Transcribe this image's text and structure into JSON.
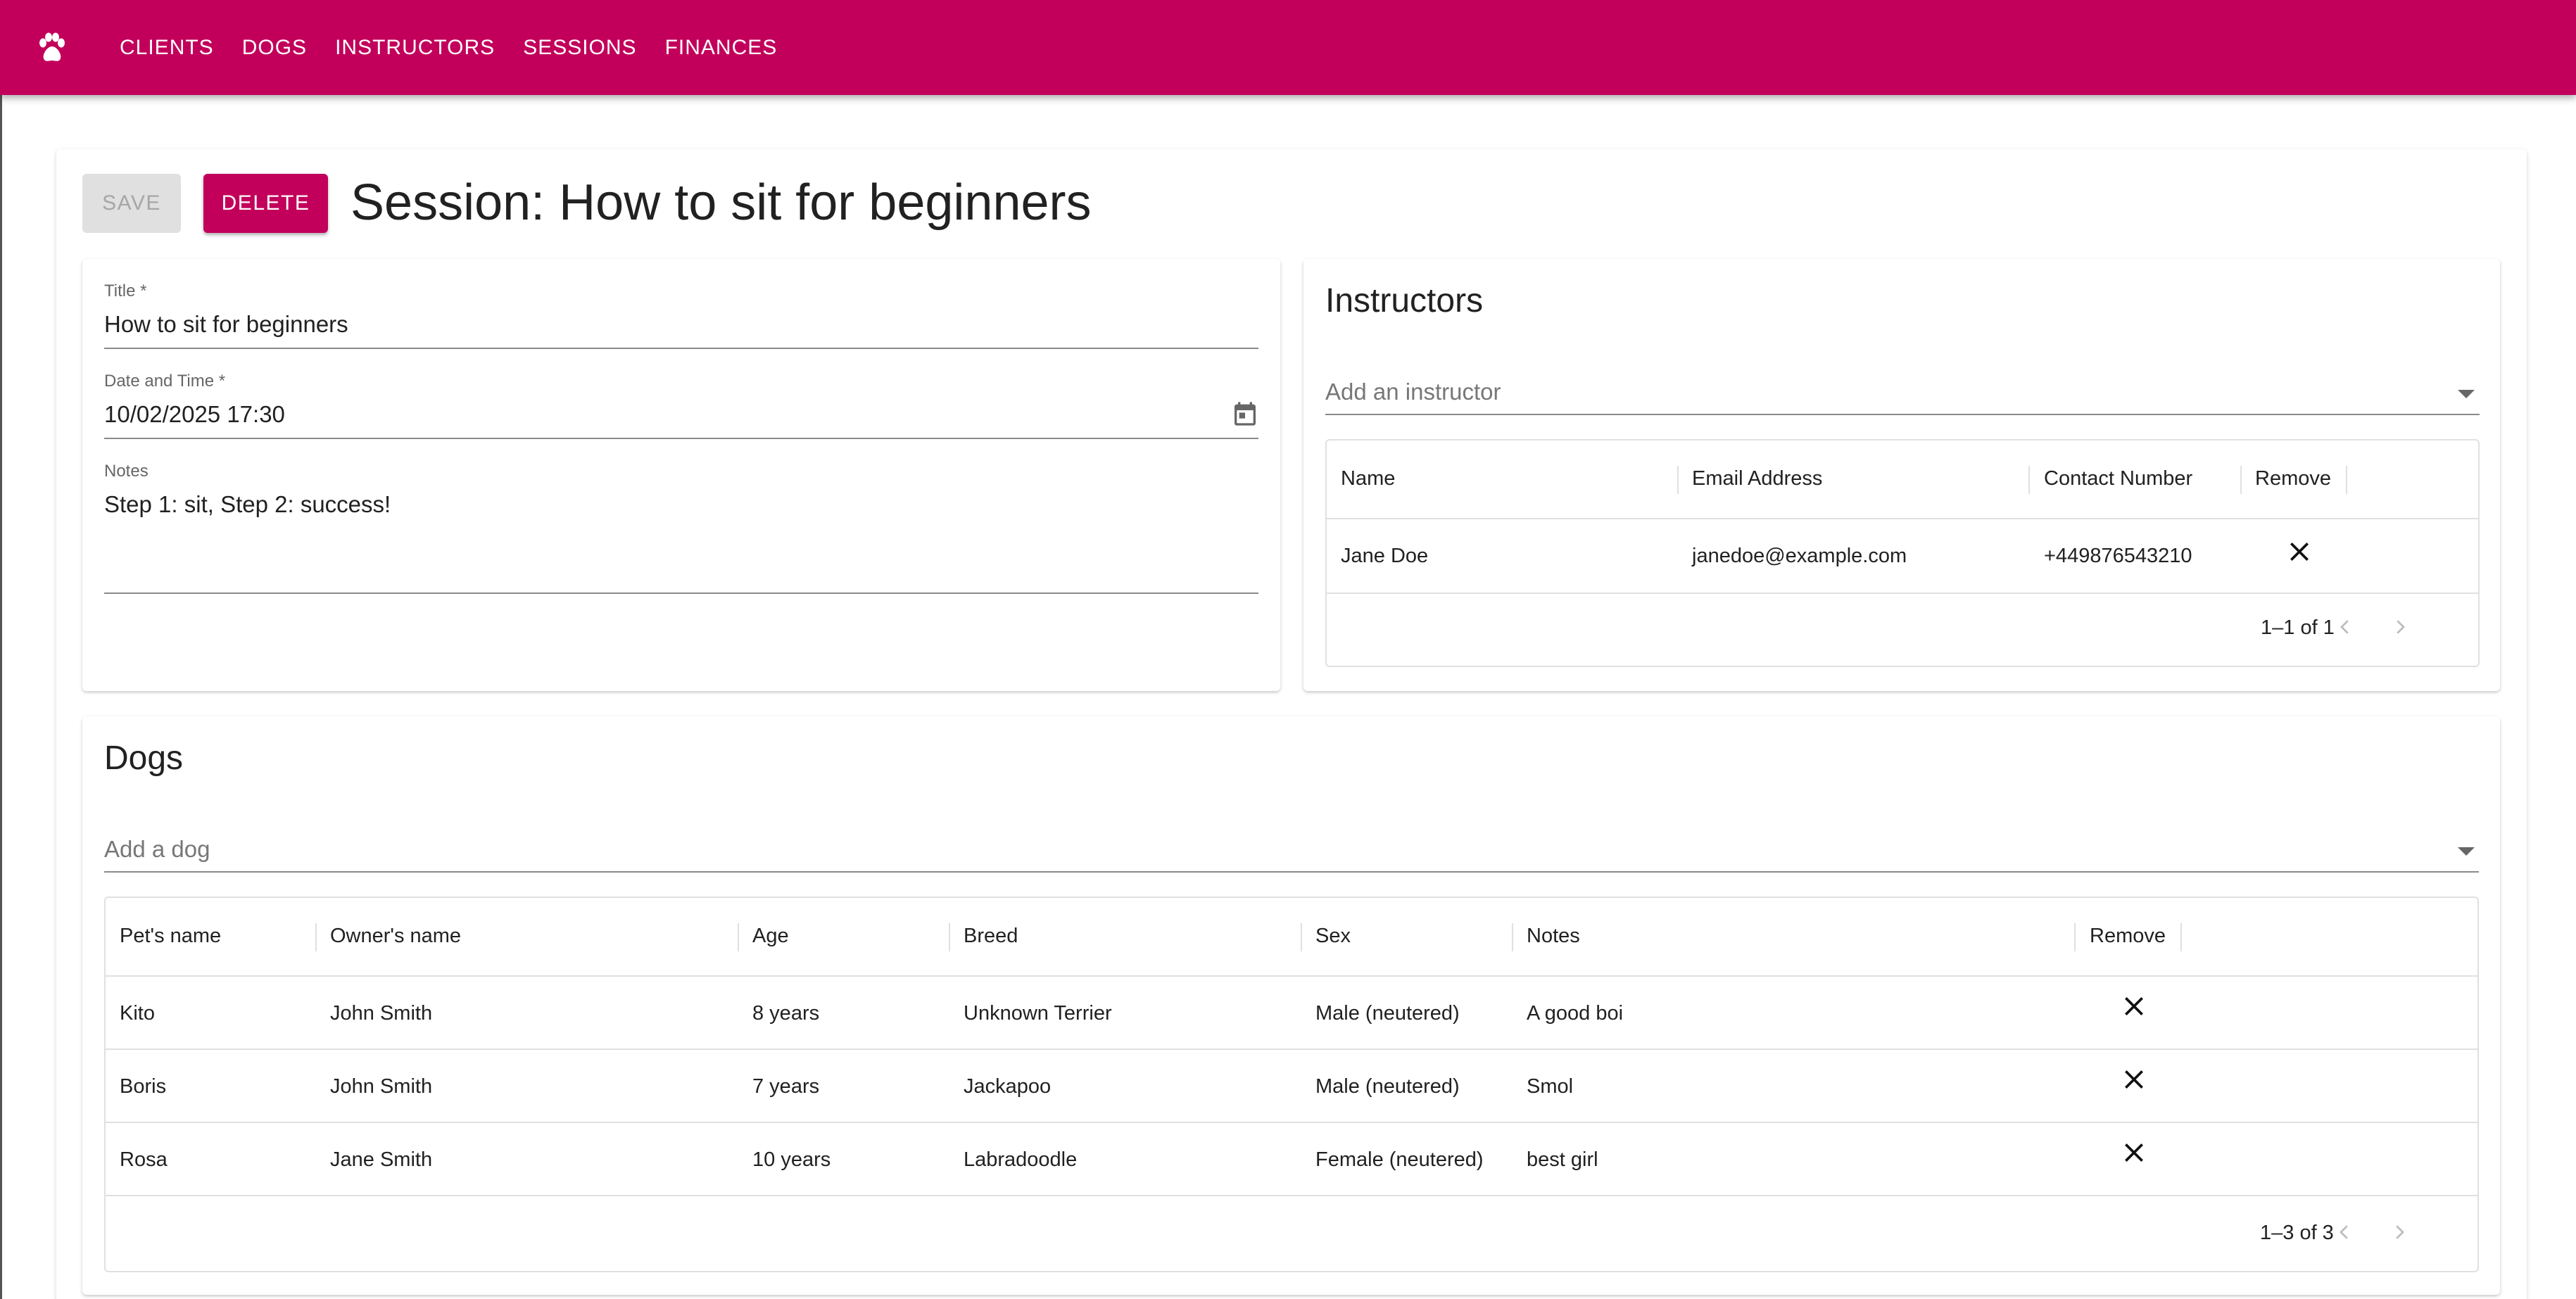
{
  "nav": {
    "items": [
      "CLIENTS",
      "DOGS",
      "INSTRUCTORS",
      "SESSIONS",
      "FINANCES"
    ]
  },
  "toolbar": {
    "save_label": "SAVE",
    "delete_label": "DELETE"
  },
  "page": {
    "title": "Session: How to sit for beginners"
  },
  "form": {
    "title_label": "Title *",
    "title_value": "How to sit for beginners",
    "datetime_label": "Date and Time *",
    "datetime_value": "10/02/2025 17:30",
    "notes_label": "Notes",
    "notes_value": "Step 1: sit, Step 2: success!"
  },
  "instructors": {
    "heading": "Instructors",
    "select_placeholder": "Add an instructor",
    "columns": [
      "Name",
      "Email Address",
      "Contact Number",
      "Remove"
    ],
    "rows": [
      {
        "name": "Jane Doe",
        "email": "janedoe@example.com",
        "phone": "+449876543210"
      }
    ],
    "pagination": "1–1 of 1"
  },
  "dogs": {
    "heading": "Dogs",
    "select_placeholder": "Add a dog",
    "columns": [
      "Pet's name",
      "Owner's name",
      "Age",
      "Breed",
      "Sex",
      "Notes",
      "Remove"
    ],
    "rows": [
      {
        "pet": "Kito",
        "owner": "John Smith",
        "age": "8 years",
        "breed": "Unknown Terrier",
        "sex": "Male (neutered)",
        "notes": "A good boi"
      },
      {
        "pet": "Boris",
        "owner": "John Smith",
        "age": "7 years",
        "breed": "Jackapoo",
        "sex": "Male (neutered)",
        "notes": "Smol"
      },
      {
        "pet": "Rosa",
        "owner": "Jane Smith",
        "age": "10 years",
        "breed": "Labradoodle",
        "sex": "Female (neutered)",
        "notes": "best girl"
      }
    ],
    "pagination": "1–3 of 3"
  },
  "colors": {
    "brand": "#c2005b",
    "disabled_bg": "#e0e0e0"
  },
  "icons": {
    "logo": "paw-icon",
    "calendar": "calendar-icon",
    "remove": "close-icon",
    "dropdown": "arrow-drop-down-icon",
    "prev": "chevron-left-icon",
    "next": "chevron-right-icon"
  }
}
